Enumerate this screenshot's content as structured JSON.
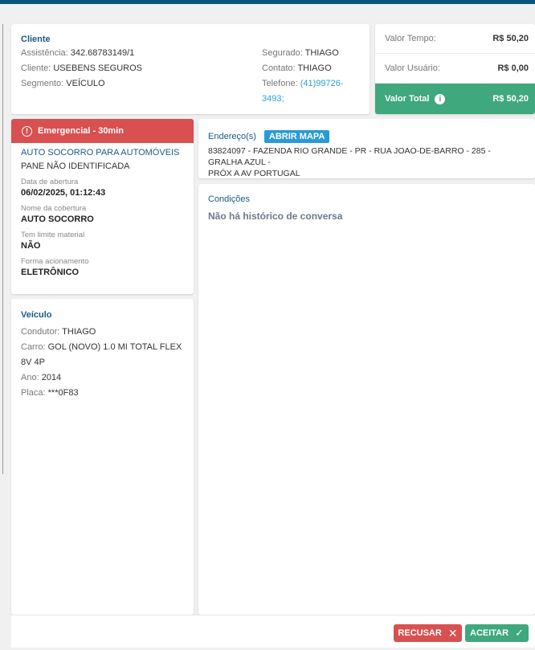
{
  "client": {
    "title": "Cliente",
    "left": [
      {
        "label": "Assistência:",
        "value": "342.68783149/1"
      },
      {
        "label": "Cliente:",
        "value": "USEBENS SEGUROS"
      },
      {
        "label": "Segmento:",
        "value": "VEÍCULO"
      }
    ],
    "right": [
      {
        "label": "Segurado:",
        "value": "THIAGO"
      },
      {
        "label": "Contato:",
        "value": "THIAGO"
      },
      {
        "label": "Telefone:",
        "value": "(41)99726-3493;"
      }
    ]
  },
  "values": {
    "tempo_label": "Valor Tempo:",
    "tempo": "R$ 50,20",
    "usuario_label": "Valor Usuário:",
    "usuario": "R$ 0,00",
    "total_label": "Valor Total",
    "total": "R$ 50,20",
    "total_color": "#3fa87c"
  },
  "emergency": {
    "header": "Emergencial - 30min",
    "header_color": "#d95050",
    "service": "AUTO SOCORRO PARA AUTOMÓVEIS",
    "problem": "PANE NÃO IDENTIFICADA",
    "fields": [
      {
        "label": "Data de abertura",
        "value": "06/02/2025, 01:12:43"
      },
      {
        "label": "Nome da cobertura",
        "value": "AUTO SOCORRO"
      },
      {
        "label": "Tem limite material",
        "value": "NÃO"
      },
      {
        "label": "Forma acionamento",
        "value": "ELETRÔNICO"
      }
    ]
  },
  "vehicle": {
    "title": "Veículo",
    "rows": [
      {
        "label": "Condutor:",
        "value": "THIAGO"
      },
      {
        "label": "Carro:",
        "value": "GOL (NOVO) 1.0 MI TOTAL FLEX 8V 4P"
      },
      {
        "label": "Ano:",
        "value": "2014"
      },
      {
        "label": "Placa:",
        "value": "***0F83"
      }
    ]
  },
  "address": {
    "title": "Endereço(s)",
    "map_button": "ABRIR MAPA",
    "line1": "83824097 - FAZENDA RIO GRANDE - PR - RUA JOAO-DE-BARRO - 285 - GRALHA AZUL -",
    "line2": "PRÓX A AV PORTUGAL"
  },
  "conditions": {
    "title": "Condições",
    "empty": "Não há histórico de conversa"
  },
  "footer": {
    "reject": "RECUSAR",
    "accept": "ACEITAR"
  }
}
